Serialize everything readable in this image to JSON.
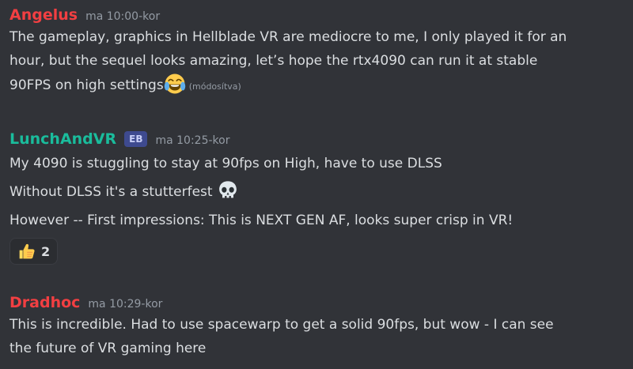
{
  "colors": {
    "background": "#313338",
    "text": "#dbdee1",
    "muted": "#949ba4",
    "username_red": "#f23f42",
    "username_teal": "#1abc9c"
  },
  "messages": [
    {
      "username": "Angelus",
      "username_color": "#f23f42",
      "timestamp": "ma 10:00-kor",
      "lines": [
        "The gameplay, graphics in Hellblade VR are mediocre to me, I only played it for an",
        "hour, but the sequel looks amazing, let’s hope the rtx4090 can run it at stable",
        "90FPS on high settings"
      ],
      "emoji": "tears-of-joy-emoji",
      "edited": "(módosítva)"
    },
    {
      "username": "LunchAndVR",
      "username_color": "#1abc9c",
      "tag": "EB",
      "timestamp": "ma 10:25-kor",
      "lines": [
        "My 4090 is stuggling to stay at 90fps on High, have to use DLSS",
        "Without DLSS it's a stutterfest",
        "However -- First impressions: This is NEXT GEN AF, looks super crisp in VR!"
      ],
      "emoji": "skull-emoji",
      "reaction": {
        "emoji": "thumbs-up-emoji",
        "count": "2"
      }
    },
    {
      "username": "Dradhoc",
      "username_color": "#f23f42",
      "timestamp": "ma 10:29-kor",
      "lines": [
        "This is incredible. Had to use spacewarp to get a solid 90fps, but wow - I can see",
        "the future of VR gaming here"
      ]
    }
  ]
}
